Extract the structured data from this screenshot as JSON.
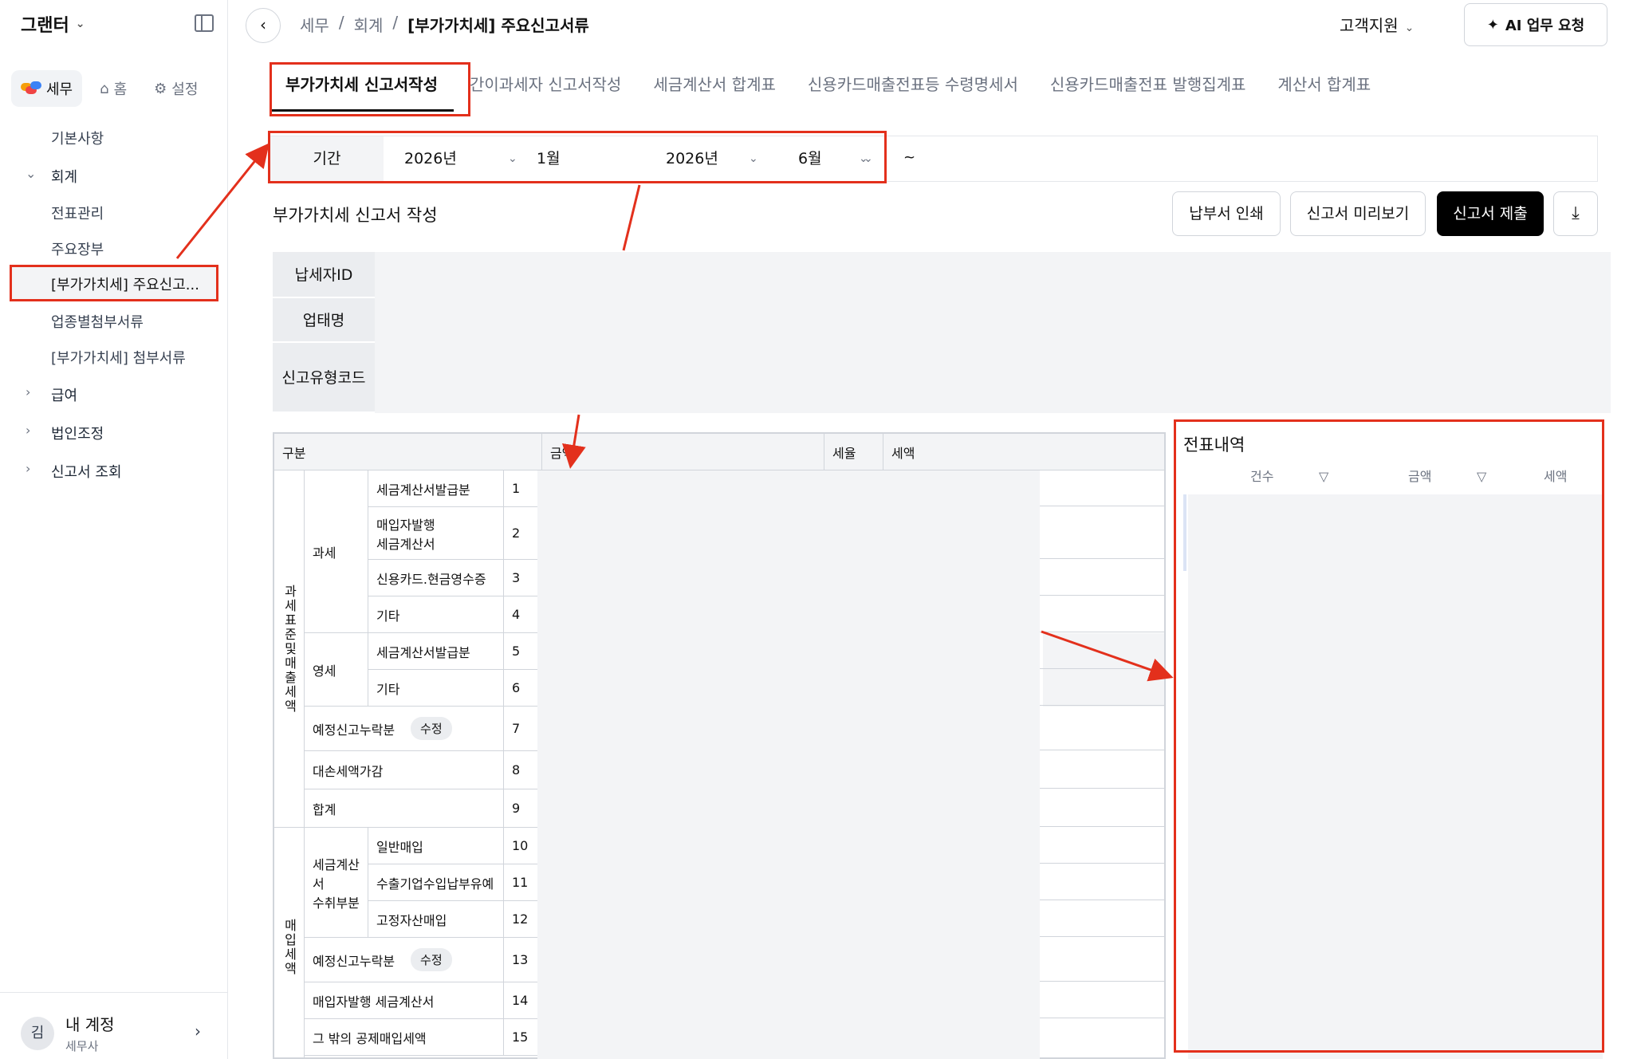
{
  "sidebar": {
    "brand": "그랜터",
    "mode_tabs": [
      {
        "label": "세무",
        "active": true
      },
      {
        "label": "홈",
        "icon": "home-icon"
      },
      {
        "label": "설정",
        "icon": "gear-icon"
      }
    ],
    "items": {
      "basic": "기본사항",
      "accounting": "회계",
      "voucher": "전표관리",
      "ledger": "주요장부",
      "vat_main": "[부가가치세] 주요신고...",
      "industry": "업종별첨부서류",
      "vat_attach": "[부가가치세] 첨부서류",
      "payroll": "급여",
      "corp": "법인조정",
      "report_query": "신고서 조회"
    },
    "account": {
      "avatar": "김",
      "name": "내 계정",
      "role": "세무사"
    }
  },
  "header": {
    "breadcrumb": [
      "세무",
      "/",
      "회계",
      "/",
      "[부가가치세] 주요신고서류"
    ],
    "support": "고객지원",
    "ai_button": "AI 업무 요청"
  },
  "tabs": [
    {
      "label": "부가가치세 신고서작성",
      "active": true
    },
    {
      "label": "간이과세자 신고서작성"
    },
    {
      "label": "세금계산서 합계표"
    },
    {
      "label": "신용카드매출전표등 수령명세서"
    },
    {
      "label": "신용카드매출전표 발행집계표"
    },
    {
      "label": "계산서 합계표"
    }
  ],
  "filter": {
    "label": "기간",
    "start_year": "2026년",
    "start_month": "1월",
    "tilde": "~",
    "end_year": "2026년",
    "end_month": "6월"
  },
  "section": {
    "title": "부가가치세 신고서 작성",
    "print_btn": "납부서 인쇄",
    "preview_btn": "신고서 미리보기",
    "submit_btn": "신고서 제출"
  },
  "info": {
    "taxpayer_id": "납세자ID",
    "business_name": "업태명",
    "report_type_code": "신고유형코드"
  },
  "table": {
    "headers": {
      "category": "구분",
      "amount": "금액",
      "rate": "세율",
      "tax": "세액"
    },
    "group_sales": "과세표준및매출세액",
    "group_purchase": "매입세액",
    "taxable": "과세",
    "zero_rated": "영세",
    "invoice_received": "세금계산서\n수취부분",
    "rows": [
      {
        "label": "세금계산서발급분",
        "no": "1"
      },
      {
        "label": "매입자발행\n세금계산서",
        "no": "2"
      },
      {
        "label": "신용카드.현금영수증",
        "no": "3"
      },
      {
        "label": "기타",
        "no": "4"
      },
      {
        "label": "세금계산서발급분",
        "no": "5"
      },
      {
        "label": "기타",
        "no": "6"
      },
      {
        "label": "예정신고누락분",
        "no": "7",
        "badge": "수정"
      },
      {
        "label": "대손세액가감",
        "no": "8"
      },
      {
        "label": "합계",
        "no": "9"
      },
      {
        "label": "일반매입",
        "no": "10"
      },
      {
        "label": "수출기업수입납부유예",
        "no": "11"
      },
      {
        "label": "고정자산매입",
        "no": "12"
      },
      {
        "label": "예정신고누락분",
        "no": "13",
        "badge": "수정"
      },
      {
        "label": "매입자발행 세금계산서",
        "no": "14"
      },
      {
        "label": "그 밖의 공제매입세액",
        "no": "15"
      }
    ]
  },
  "panel": {
    "title": "전표내역",
    "headers": {
      "count": "건수",
      "amount": "금액",
      "tax": "세액"
    }
  },
  "colors": {
    "annotation": "#e3301c",
    "primary_button": "#000000",
    "muted_bg": "#f3f4f6"
  }
}
